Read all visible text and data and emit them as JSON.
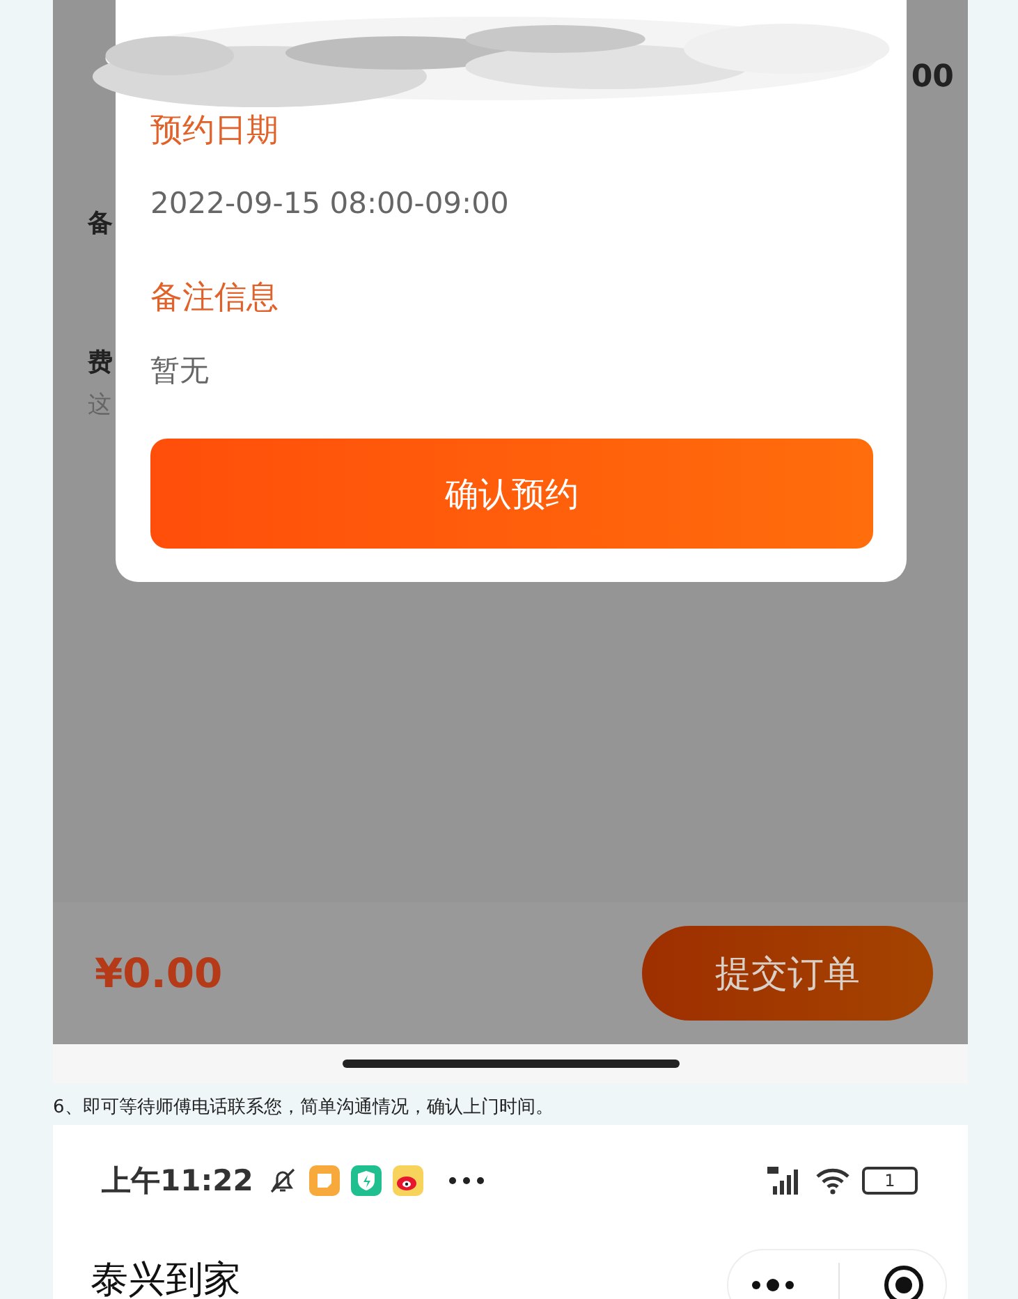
{
  "screenshot_1": {
    "background_rows": [
      {
        "kind": "amount",
        "text": "00"
      },
      {
        "kind": "heading",
        "text": "备"
      },
      {
        "kind": "heading",
        "text": "费"
      },
      {
        "kind": "note",
        "text": "这"
      }
    ],
    "dialog": {
      "fields": [
        {
          "label": "预约日期",
          "value": "2022-09-15 08:00-09:00"
        },
        {
          "label": "备注信息",
          "value": "暂无"
        }
      ],
      "confirm_button": "确认预约"
    },
    "footer": {
      "price": "¥0.00",
      "submit_button": "提交订单"
    }
  },
  "caption": "6、即可等待师傅电话联系您，简单沟通情况，确认上门时间。",
  "screenshot_2": {
    "status_bar": {
      "time": "上午11:22",
      "battery": "1"
    },
    "title": "泰兴到家"
  }
}
